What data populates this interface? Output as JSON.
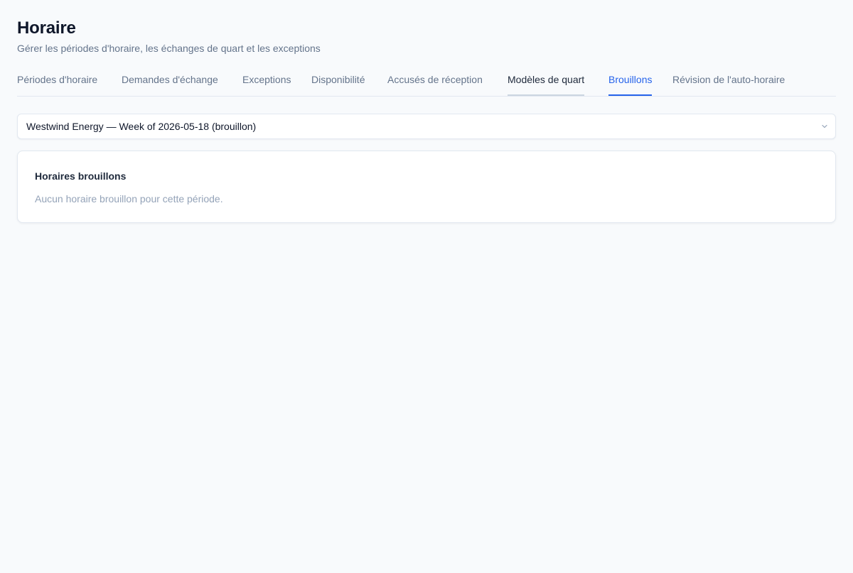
{
  "header": {
    "title": "Horaire",
    "subtitle": "Gérer les périodes d'horaire, les échanges de quart et les exceptions"
  },
  "tabs": [
    {
      "label": "Périodes d'horaire",
      "state": "default"
    },
    {
      "label": "Demandes d'échange",
      "state": "default"
    },
    {
      "label": "Exceptions",
      "state": "default"
    },
    {
      "label": "Disponibilité",
      "state": "default"
    },
    {
      "label": "Accusés de réception",
      "state": "default"
    },
    {
      "label": "Modèles de quart",
      "state": "hovered"
    },
    {
      "label": "Brouillons",
      "state": "active"
    },
    {
      "label": "Révision de l'auto-horaire",
      "state": "default"
    }
  ],
  "period_select": {
    "selected": "Westwind Energy — Week of 2026-05-18 (brouillon)",
    "icon": "chevron-down-icon"
  },
  "drafts_card": {
    "title": "Horaires brouillons",
    "empty_message": "Aucun horaire brouillon pour cette période."
  },
  "colors": {
    "background": "#f8fafc",
    "accent": "#2563eb",
    "text_muted": "#64748b",
    "border": "#e2e8f0"
  }
}
